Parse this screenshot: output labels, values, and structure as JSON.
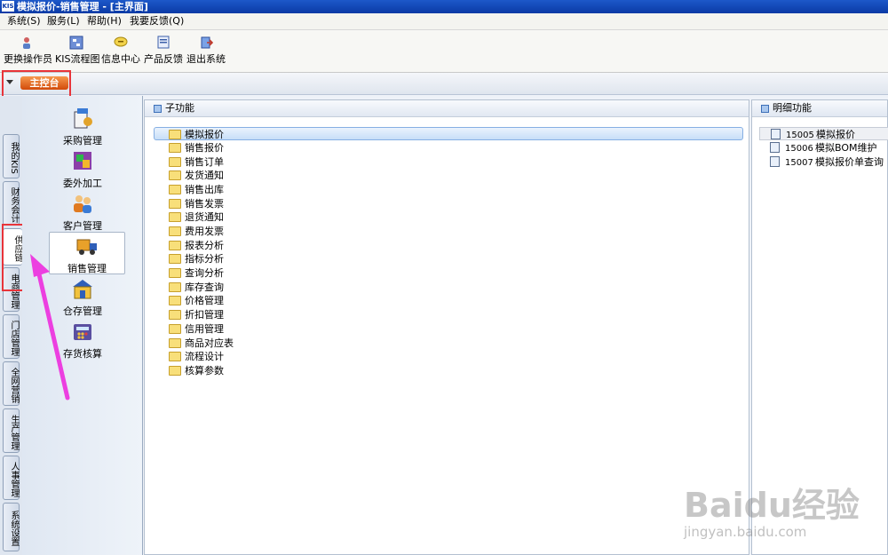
{
  "window": {
    "logo": "KIS",
    "title": "模拟报价-销售管理 - [主界面]"
  },
  "menu": [
    "系统(S)",
    "服务(L)",
    "帮助(H)",
    "我要反馈(Q)"
  ],
  "toolbar": [
    {
      "label": "更换操作员",
      "icon": "user-switch-icon"
    },
    {
      "label": "KIS流程图",
      "icon": "flowchart-icon"
    },
    {
      "label": "信息中心",
      "icon": "message-icon"
    },
    {
      "label": "产品反馈",
      "icon": "feedback-icon"
    },
    {
      "label": "退出系统",
      "icon": "exit-icon"
    }
  ],
  "console_tab": "主控台",
  "vertical_tabs": [
    "我的KIS",
    "财务会计",
    "供应链",
    "电商管理",
    "门店管理",
    "全网营销",
    "生产管理",
    "人事管理",
    "系统设置"
  ],
  "active_vertical_tab": "供应链",
  "modules": [
    {
      "label": "采购管理",
      "icon": "purchase-icon"
    },
    {
      "label": "委外加工",
      "icon": "outsourcing-icon"
    },
    {
      "label": "客户管理",
      "icon": "customer-icon"
    },
    {
      "label": "销售管理",
      "icon": "sales-truck-icon"
    },
    {
      "label": "仓存管理",
      "icon": "warehouse-icon"
    },
    {
      "label": "存货核算",
      "icon": "calculator-icon"
    }
  ],
  "selected_module": "销售管理",
  "subfunction": {
    "title": "子功能",
    "items": [
      "模拟报价",
      "销售报价",
      "销售订单",
      "发货通知",
      "销售出库",
      "销售发票",
      "退货通知",
      "费用发票",
      "报表分析",
      "指标分析",
      "查询分析",
      "库存查询",
      "价格管理",
      "折扣管理",
      "信用管理",
      "商品对应表",
      "流程设计",
      "核算参数"
    ],
    "selected": "模拟报价"
  },
  "detail": {
    "title": "明细功能",
    "items": [
      {
        "code": "15005",
        "label": "模拟报价"
      },
      {
        "code": "15006",
        "label": "模拟BOM维护"
      },
      {
        "code": "15007",
        "label": "模拟报价单查询"
      }
    ]
  },
  "watermark": {
    "text": "Baidu经验",
    "sub": "jingyan.baidu.com"
  },
  "colors": {
    "titlebar": "#0a3aa5",
    "tab_orange": "#d24a0a",
    "highlight_red": "#e8343a",
    "arrow_pink": "#ec3fe0",
    "selection": "#c7def8"
  }
}
